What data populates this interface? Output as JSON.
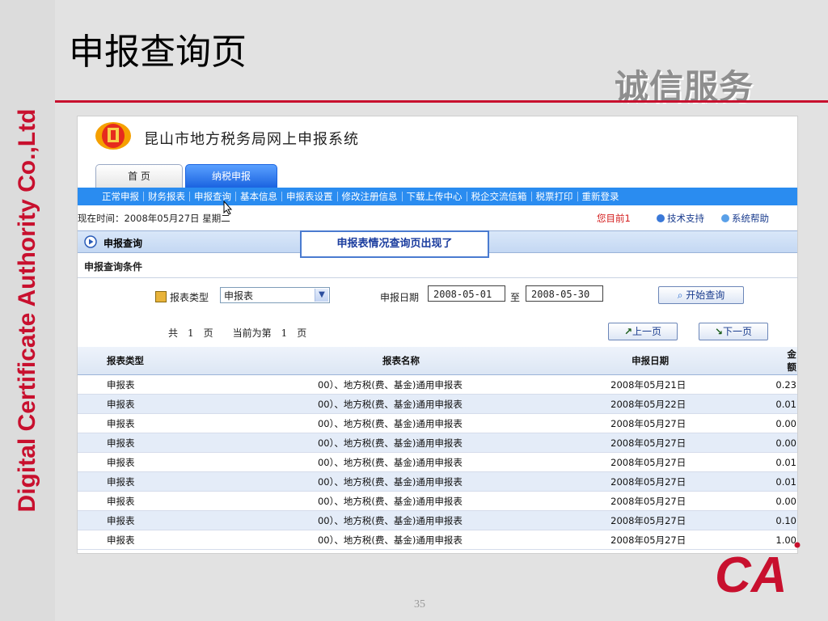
{
  "slide": {
    "title": "申报查询页",
    "slogan": "诚信服务",
    "side_text": "Digital Certificate Authority Co.,Ltd",
    "page_number": "35",
    "logo_text": "CA",
    "colors": {
      "accent_red": "#c8102e",
      "menu_blue": "#2a8cf0"
    }
  },
  "app": {
    "title": "昆山市地方税务局网上申报系统",
    "tabs": [
      {
        "label": "首 页"
      },
      {
        "label": "纳税申报"
      }
    ],
    "menu": [
      "正常申报",
      "财务报表",
      "申报查询",
      "基本信息",
      "申报表设置",
      "修改注册信息",
      "下载上传中心",
      "税企交流信箱",
      "税票打印",
      "重新登录"
    ],
    "info": {
      "datetime": "现在时间：2008年05月27日 星期二",
      "status": "您目前1",
      "tech_support": "技术支持",
      "help": "系统帮助"
    }
  },
  "panel": {
    "title": "申报查询",
    "callout": "申报表情况查询页出现了",
    "conditions_label": "申报查询条件",
    "form": {
      "type_label": "报表类型",
      "type_value": "申报表",
      "date_label": "申报日期",
      "date_from": "2008-05-01",
      "to_label": "至",
      "date_to": "2008-05-30",
      "query_button": "开始查询"
    },
    "pager": {
      "text": "共　1　页　　当前为第　1　页",
      "prev": "上一页",
      "next": "下一页"
    },
    "table": {
      "headers": [
        "报表类型",
        "报表名称",
        "申报日期",
        "金额"
      ],
      "rows": [
        [
          "申报表",
          "00）、地方税(费、基金)通用申报表",
          "2008年05月21日",
          "0.23"
        ],
        [
          "申报表",
          "00）、地方税(费、基金)通用申报表",
          "2008年05月22日",
          "0.01"
        ],
        [
          "申报表",
          "00）、地方税(费、基金)通用申报表",
          "2008年05月27日",
          "0.00"
        ],
        [
          "申报表",
          "00）、地方税(费、基金)通用申报表",
          "2008年05月27日",
          "0.00"
        ],
        [
          "申报表",
          "00）、地方税(费、基金)通用申报表",
          "2008年05月27日",
          "0.01"
        ],
        [
          "申报表",
          "00）、地方税(费、基金)通用申报表",
          "2008年05月27日",
          "0.01"
        ],
        [
          "申报表",
          "00）、地方税(费、基金)通用申报表",
          "2008年05月27日",
          "0.00"
        ],
        [
          "申报表",
          "00）、地方税(费、基金)通用申报表",
          "2008年05月27日",
          "0.10"
        ],
        [
          "申报表",
          "00）、地方税(费、基金)通用申报表",
          "2008年05月27日",
          "1.00"
        ]
      ]
    }
  }
}
